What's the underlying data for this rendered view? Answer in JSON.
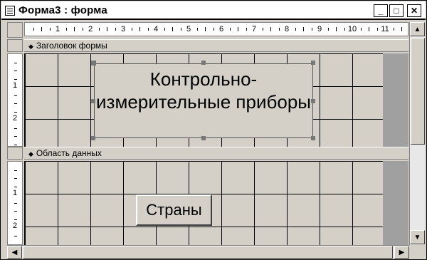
{
  "window": {
    "title": "Форма3 : форма",
    "minimize": "_",
    "maximize": "□",
    "close": "✕"
  },
  "ruler": {
    "numbers": [
      "1",
      "2",
      "3",
      "4",
      "5",
      "6",
      "7",
      "8",
      "9",
      "10",
      "11"
    ]
  },
  "vruler": {
    "header_numbers": [
      "1",
      "2"
    ],
    "detail_numbers": [
      "1",
      "2"
    ]
  },
  "sections": {
    "header_label": "Заголовок формы",
    "detail_label": "Область данных"
  },
  "form": {
    "header_text": "Контрольно-измерительные приборы",
    "button_label": "Страны"
  },
  "icons": {
    "app": "form-window-icon",
    "section_arrow": "section-arrow-icon",
    "scroll_up": "up-arrow-icon",
    "scroll_down": "down-arrow-icon",
    "scroll_left": "left-arrow-icon",
    "scroll_right": "right-arrow-icon"
  }
}
